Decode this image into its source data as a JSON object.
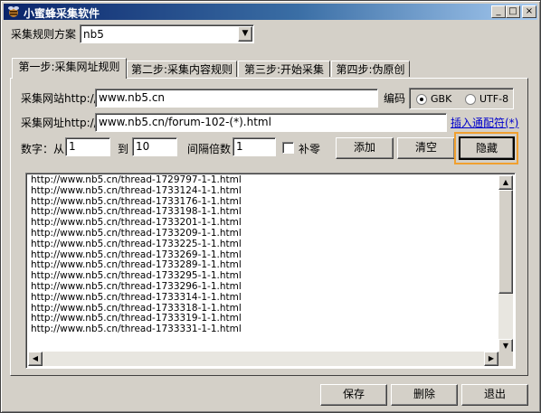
{
  "window": {
    "title": "小蜜蜂采集软件",
    "min_label": "_",
    "max_label": "□",
    "close_label": "×"
  },
  "rule_scheme": {
    "label": "采集规则方案",
    "value": "nb5",
    "arrow": "▼"
  },
  "tabs": [
    {
      "label": "第一步:采集网址规则",
      "active": true
    },
    {
      "label": "第二步:采集内容规则",
      "active": false
    },
    {
      "label": "第三步:开始采集",
      "active": false
    },
    {
      "label": "第四步:伪原创",
      "active": false
    }
  ],
  "site": {
    "label": "采集网站http://",
    "value": "www.nb5.cn"
  },
  "encoding": {
    "label": "编码",
    "options": [
      "GBK",
      "UTF-8"
    ],
    "selected": "GBK"
  },
  "url": {
    "label": "采集网址http://",
    "value": "www.nb5.cn/forum-102-(*).html",
    "insert_link": "插入通配符(*)"
  },
  "range": {
    "from_label": "数字：从",
    "from_value": "1",
    "to_label": "到",
    "to_value": "10",
    "step_label": "间隔倍数",
    "step_value": "1",
    "pad_label": "补零",
    "pad_checked": false
  },
  "actions": {
    "add": "添加",
    "clear": "清空",
    "hide": "隐藏"
  },
  "url_list": [
    "http://www.nb5.cn/thread-1729797-1-1.html",
    "http://www.nb5.cn/thread-1733124-1-1.html",
    "http://www.nb5.cn/thread-1733176-1-1.html",
    "http://www.nb5.cn/thread-1733198-1-1.html",
    "http://www.nb5.cn/thread-1733201-1-1.html",
    "http://www.nb5.cn/thread-1733209-1-1.html",
    "http://www.nb5.cn/thread-1733225-1-1.html",
    "http://www.nb5.cn/thread-1733269-1-1.html",
    "http://www.nb5.cn/thread-1733289-1-1.html",
    "http://www.nb5.cn/thread-1733295-1-1.html",
    "http://www.nb5.cn/thread-1733296-1-1.html",
    "http://www.nb5.cn/thread-1733314-1-1.html",
    "http://www.nb5.cn/thread-1733318-1-1.html",
    "http://www.nb5.cn/thread-1733319-1-1.html",
    "http://www.nb5.cn/thread-1733331-1-1.html"
  ],
  "footer": {
    "save": "保存",
    "delete": "删除",
    "exit": "退出"
  },
  "colors": {
    "highlight": "#f0a030",
    "title_bar": "#0a246a",
    "link": "#0000cc"
  }
}
